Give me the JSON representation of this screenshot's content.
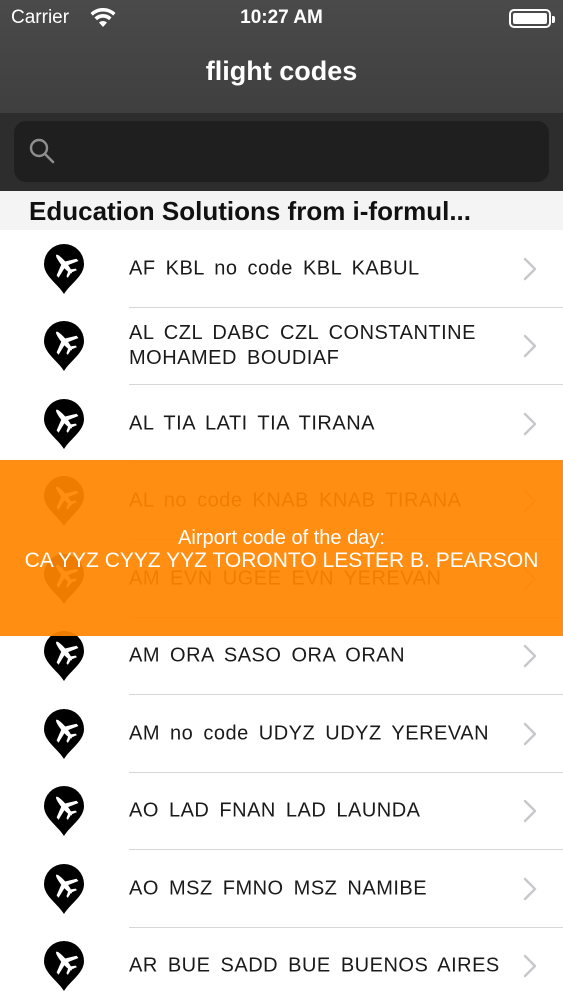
{
  "status_bar": {
    "carrier": "Carrier",
    "time": "10:27 AM"
  },
  "nav": {
    "title": "flight codes"
  },
  "search": {
    "placeholder": "",
    "value": ""
  },
  "section": {
    "header": "Education Solutions from i-formul..."
  },
  "list": {
    "items": [
      {
        "label": "AF  KBL  no code  KBL  KABUL"
      },
      {
        "label": "AL  CZL  DABC  CZL  CONSTANTINE MOHAMED BOUDIAF"
      },
      {
        "label": "AL  TIA  LATI  TIA  TIRANA"
      },
      {
        "label": "AL  no code  KNAB  KNAB  TIRANA"
      },
      {
        "label": "AM  EVN  UGEE  EVN  YEREVAN"
      },
      {
        "label": "AM  ORA  SASO  ORA  ORAN"
      },
      {
        "label": "AM  no code  UDYZ  UDYZ  YEREVAN"
      },
      {
        "label": "AO  LAD  FNAN  LAD  LAUNDA"
      },
      {
        "label": "AO  MSZ  FMNO  MSZ  NAMIBE"
      },
      {
        "label": "AR  BUE  SADD  BUE  BUENOS AIRES"
      }
    ]
  },
  "toast": {
    "heading": "Airport code of the day:",
    "message": "CA  YYZ  CYYZ  YYZ  TORONTO LESTER B. PEARSON"
  },
  "colors": {
    "nav_bg": "#444444",
    "search_bg": "#2d2d2d",
    "toast_bg": "#ff8500",
    "separator": "#d6d6d6"
  },
  "icons": {
    "row_icon": "airplane-pin-icon",
    "row_accessory": "chevron-right-icon",
    "search": "search-icon",
    "wifi": "wifi-icon",
    "battery": "battery-icon"
  }
}
